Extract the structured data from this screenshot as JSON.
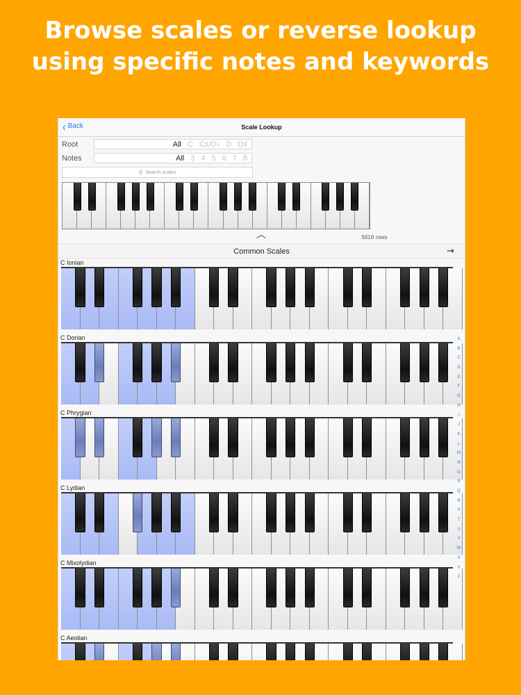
{
  "headline": {
    "line1": "Browse scales or reverse lookup",
    "line2": "using specific notes and keywords"
  },
  "navbar": {
    "back_label": "Back",
    "title": "Scale Lookup"
  },
  "filters": {
    "root": {
      "label": "Root",
      "options": [
        "All",
        "C",
        "C♯/D♭",
        "D",
        "D♯"
      ],
      "selected": "All"
    },
    "notes": {
      "label": "Notes",
      "options": [
        "All",
        "3",
        "4",
        "5",
        "6",
        "7",
        "8"
      ],
      "selected": "All"
    }
  },
  "search": {
    "placeholder": "Search scales",
    "icon": "magnifier-icon"
  },
  "results": {
    "row_count_text": "5616 rows",
    "handle_icon": "chevron-up-icon"
  },
  "section": {
    "title": "Common Scales",
    "arrow_icon": "arrow-right-icon"
  },
  "scales": [
    {
      "name": "C Ionian",
      "notes": [
        0,
        2,
        4,
        5,
        7,
        9,
        11
      ]
    },
    {
      "name": "C Dorian",
      "notes": [
        0,
        2,
        3,
        5,
        7,
        9,
        10
      ]
    },
    {
      "name": "C Phrygian",
      "notes": [
        0,
        1,
        3,
        5,
        7,
        8,
        10
      ]
    },
    {
      "name": "C Lydian",
      "notes": [
        0,
        2,
        4,
        6,
        7,
        9,
        11
      ]
    },
    {
      "name": "C Mixolydian",
      "notes": [
        0,
        2,
        4,
        5,
        7,
        9,
        10
      ]
    },
    {
      "name": "C Aeolian",
      "notes": [
        0,
        2,
        3,
        5,
        7,
        8,
        10
      ]
    }
  ],
  "alphabet_index": [
    "A",
    "B",
    "C",
    "D",
    "E",
    "F",
    "G",
    "H",
    "I",
    "J",
    "K",
    "L",
    "M",
    "N",
    "O",
    "P",
    "Q",
    "R",
    "S",
    "T",
    "U",
    "V",
    "W",
    "X",
    "Y",
    "Z"
  ],
  "colors": {
    "background": "#FFA500",
    "accent": "#1a7cf5",
    "highlight_key": "#b3c2f7"
  }
}
